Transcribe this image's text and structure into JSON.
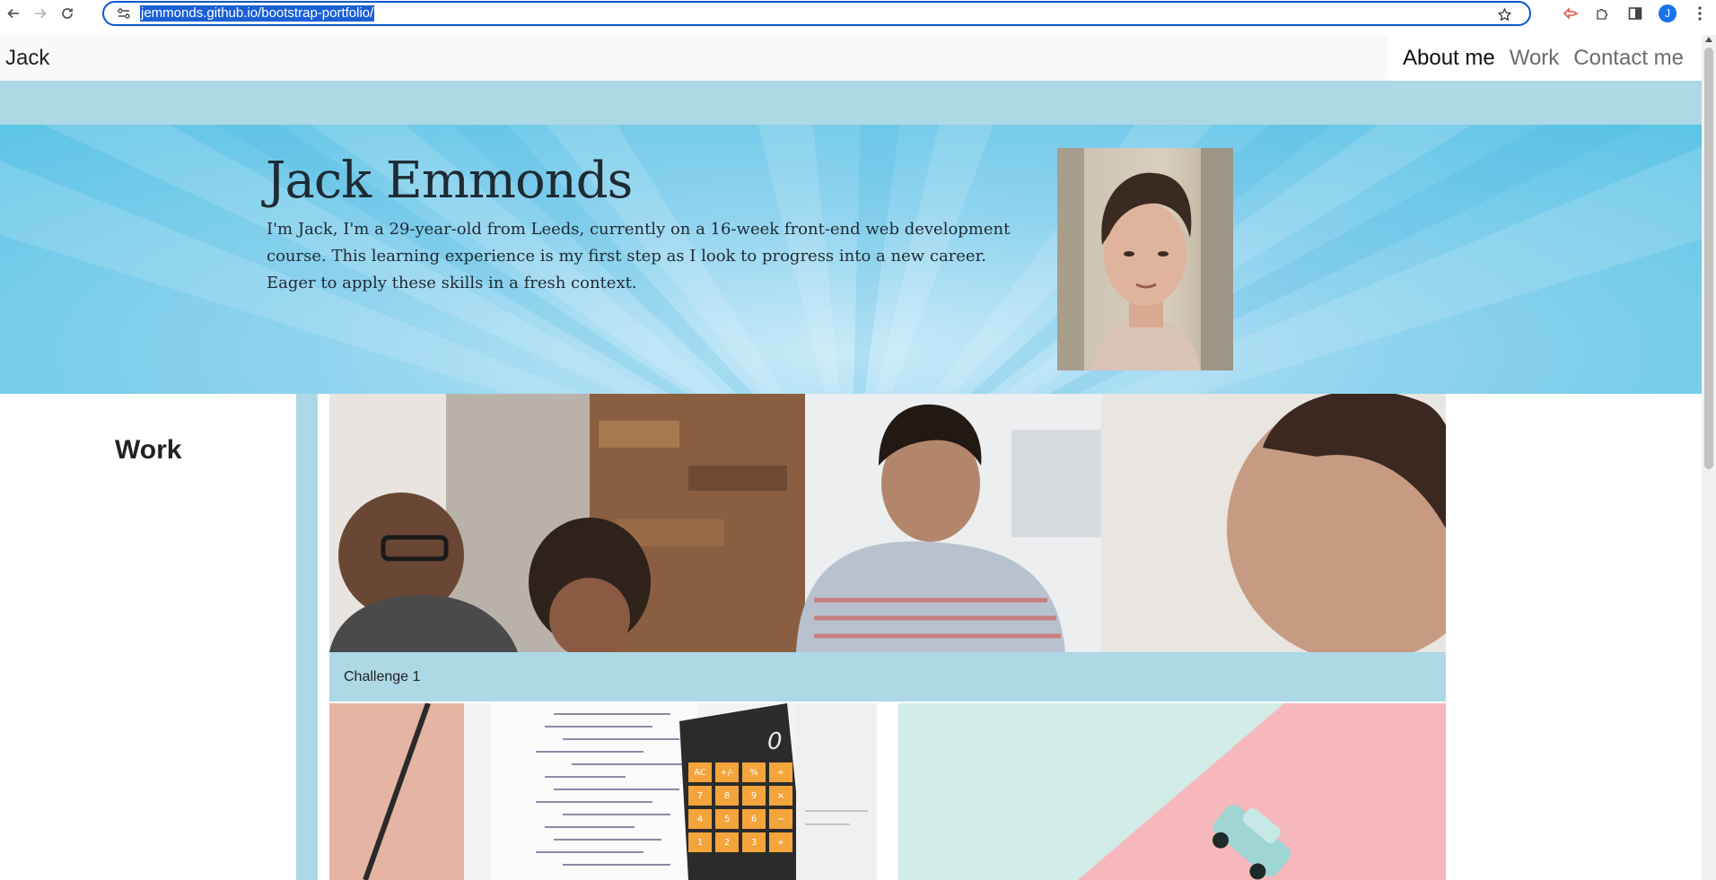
{
  "browser": {
    "url": "jemmonds.github.io/bootstrap-portfolio/",
    "profile_initial": "J"
  },
  "navbar": {
    "brand": "Jack",
    "links": [
      "About me",
      "Work",
      "Contact me"
    ],
    "active": "About me"
  },
  "hero": {
    "title": "Jack Emmonds",
    "intro": "I'm Jack, I'm a 29-year-old from Leeds, currently on a 16-week front-end web development course. This learning experience is my first step as I look to progress into a new career. Eager to apply these skills in a fresh context."
  },
  "work": {
    "heading": "Work",
    "cards": [
      {
        "caption": "Challenge 1"
      }
    ],
    "calculator_display": "0",
    "calculator_keys": [
      "AC",
      "+/-",
      "%",
      "÷",
      "7",
      "8",
      "9",
      "×",
      "4",
      "5",
      "6",
      "−",
      "1",
      "2",
      "3",
      "+"
    ]
  },
  "colors": {
    "accent_band": "#add8e6",
    "navbar_bg": "#f8f9fa",
    "link_active": "#111111",
    "link_inactive": "#6c6c6c"
  }
}
